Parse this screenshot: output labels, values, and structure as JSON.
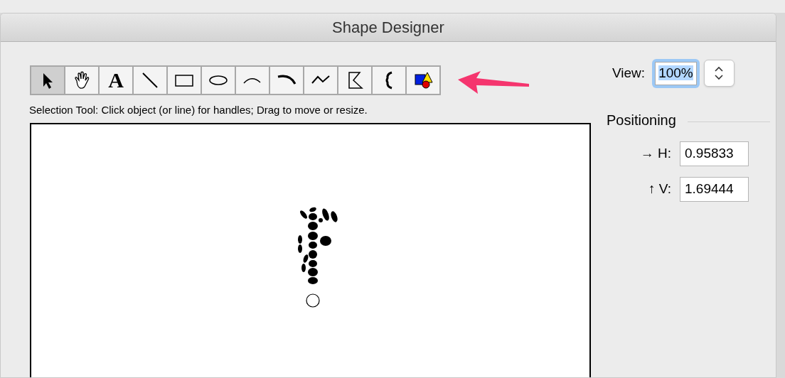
{
  "window": {
    "title": "Shape Designer"
  },
  "tools": [
    {
      "kind": "arrow",
      "selected": true
    },
    {
      "kind": "hand",
      "selected": false
    },
    {
      "kind": "text",
      "label": "A",
      "selected": false
    },
    {
      "kind": "line",
      "selected": false
    },
    {
      "kind": "rect",
      "selected": false
    },
    {
      "kind": "oval",
      "selected": false
    },
    {
      "kind": "arc",
      "selected": false
    },
    {
      "kind": "thick-arc",
      "selected": false
    },
    {
      "kind": "zigzag",
      "selected": false
    },
    {
      "kind": "polygon",
      "selected": false
    },
    {
      "kind": "brace",
      "selected": false
    },
    {
      "kind": "color",
      "selected": false
    }
  ],
  "hint": "Selection Tool: Click object (or line) for handles; Drag to move or resize.",
  "view": {
    "label": "View:",
    "value": "100%"
  },
  "positioning": {
    "title": "Positioning",
    "fields": [
      {
        "label": "→ H:",
        "value": "0.95833"
      },
      {
        "label": "↑ V:",
        "value": "1.69444"
      }
    ]
  }
}
